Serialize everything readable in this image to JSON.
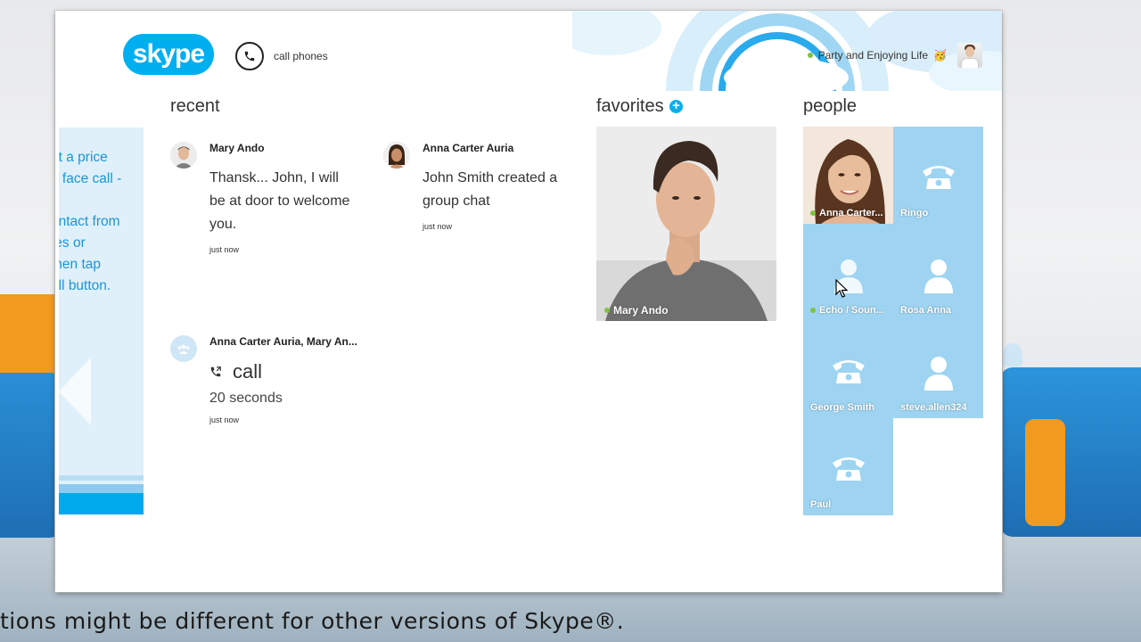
{
  "app": {
    "logo_text": "skype"
  },
  "header": {
    "call_phones_label": "call phones",
    "status_text": "Party and Enjoying Life",
    "status_emoji": "🥳",
    "status_color": "#7dc242"
  },
  "left_hint": {
    "lines": [
      "ut a price",
      "o face call -",
      "t.",
      "ontact from",
      "tes or",
      "then tap",
      "all button."
    ]
  },
  "recent": {
    "title": "recent",
    "items": [
      {
        "name": "Mary Ando",
        "message": "Thansk... John, I will be at door to welcome you.",
        "time": "just now"
      },
      {
        "name": "Anna Carter Auria",
        "message": "John Smith created a group chat",
        "time": "just now"
      },
      {
        "name": "Anna Carter Auria, Mary An...",
        "call_label": "call",
        "duration": "20 seconds",
        "time": "just now"
      }
    ]
  },
  "favorites": {
    "title": "favorites",
    "add_icon": "+",
    "tiles": [
      {
        "name": "Mary Ando",
        "online": true
      }
    ]
  },
  "people": {
    "title": "people",
    "tiles": [
      {
        "name": "Anna Carter...",
        "type": "photo",
        "online": true
      },
      {
        "name": "Ringo",
        "type": "phone"
      },
      {
        "name": "Echo / Soun...",
        "type": "person",
        "online": true
      },
      {
        "name": "Rosa Anna",
        "type": "person"
      },
      {
        "name": "George Smith",
        "type": "phone"
      },
      {
        "name": "steve.allen324",
        "type": "person"
      },
      {
        "name": "Paul",
        "type": "phone"
      }
    ]
  },
  "caption": "tions might be different for other versions of Skype®.",
  "colors": {
    "brand": "#00aff0",
    "tile": "#9ed4f1",
    "hint_text": "#1b95d8"
  }
}
